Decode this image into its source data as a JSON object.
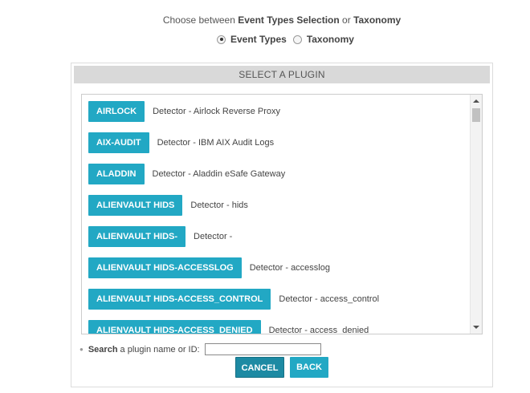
{
  "chooser": {
    "prefix": "Choose between ",
    "option1": "Event Types Selection",
    "middle": " or ",
    "option2": "Taxonomy"
  },
  "radios": [
    {
      "label": "Event Types",
      "checked": true
    },
    {
      "label": "Taxonomy",
      "checked": false
    }
  ],
  "panel": {
    "title": "SELECT A PLUGIN"
  },
  "plugins": [
    {
      "name": "AIRLOCK",
      "description": "Detector - Airlock Reverse Proxy"
    },
    {
      "name": "AIX-AUDIT",
      "description": "Detector - IBM AIX Audit Logs"
    },
    {
      "name": "ALADDIN",
      "description": "Detector - Aladdin eSafe Gateway"
    },
    {
      "name": "ALIENVAULT HIDS",
      "description": "Detector - hids"
    },
    {
      "name": "ALIENVAULT HIDS-",
      "description": "Detector -"
    },
    {
      "name": "ALIENVAULT HIDS-ACCESSLOG",
      "description": "Detector - accesslog"
    },
    {
      "name": "ALIENVAULT HIDS-ACCESS_CONTROL",
      "description": "Detector - access_control"
    },
    {
      "name": "ALIENVAULT HIDS-ACCESS_DENIED",
      "description": "Detector - access_denied"
    }
  ],
  "search": {
    "label_bold": "Search",
    "label_rest": " a plugin name or ID:",
    "value": ""
  },
  "buttons": {
    "cancel": "CANCEL",
    "back": "BACK"
  },
  "colors": {
    "plugin_button": "#22a8c4",
    "cancel_button": "#1d8aa3",
    "header_bg": "#d9d9d9"
  }
}
